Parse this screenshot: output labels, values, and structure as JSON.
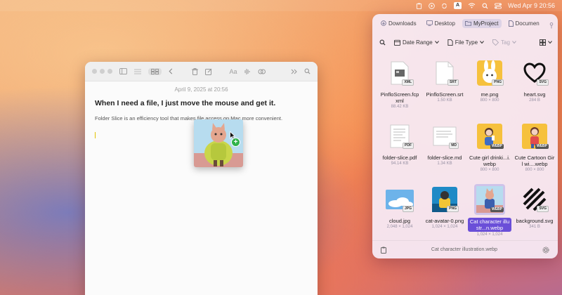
{
  "menubar": {
    "input_badge": "A",
    "datetime": "Wed Apr 9  20:56"
  },
  "note": {
    "date": "April 9, 2025 at 20:56",
    "title": "When I need a file, I just move the mouse and get it.",
    "body": "Folder Slice is an efficiency tool that makes file access on Mac more convenient.",
    "toolbar_font_label": "Aa"
  },
  "drag": {
    "badge": "+"
  },
  "panel": {
    "tabs": [
      {
        "label": "Downloads"
      },
      {
        "label": "Desktop"
      },
      {
        "label": "MyProject"
      },
      {
        "label": "Documen"
      }
    ],
    "active_tab": 2,
    "filters": {
      "date_range": "Date Range",
      "file_type": "File Type",
      "tag": "Tag"
    },
    "files": [
      {
        "name": "PinfloScreen.fcpxml",
        "meta": "88.42 KB",
        "badge": "XML"
      },
      {
        "name": "PinfloScreen.srt",
        "meta": "1.50 KB",
        "badge": "SRT"
      },
      {
        "name": "me.png",
        "meta": "800 × 800",
        "badge": "PNG"
      },
      {
        "name": "heart.svg",
        "meta": "284 B",
        "badge": "SVG"
      },
      {
        "name": "folder-slice.pdf",
        "meta": "94.14 KB",
        "badge": "PDF"
      },
      {
        "name": "folder-slice.md",
        "meta": "1.34 KB",
        "badge": "MD"
      },
      {
        "name": "Cute girl drinki...i.webp",
        "meta": "800 × 800",
        "badge": "WEBP"
      },
      {
        "name": "Cute Cartoon Girl wi....webp",
        "meta": "800 × 800",
        "badge": "WEBP"
      },
      {
        "name": "cloud.jpg",
        "meta": "2,048 × 1,024",
        "badge": "JPG"
      },
      {
        "name": "cat-avatar-0.png",
        "meta": "1,024 × 1,024",
        "badge": "PNG"
      },
      {
        "name": "Cat character illustr...n.webp",
        "meta": "1,024 × 1,024",
        "badge": "WEBP"
      },
      {
        "name": "background.svg",
        "meta": "341 B",
        "badge": "SVG"
      }
    ],
    "selected_index": 10,
    "footer_text": "Cat character illustration.webp"
  }
}
